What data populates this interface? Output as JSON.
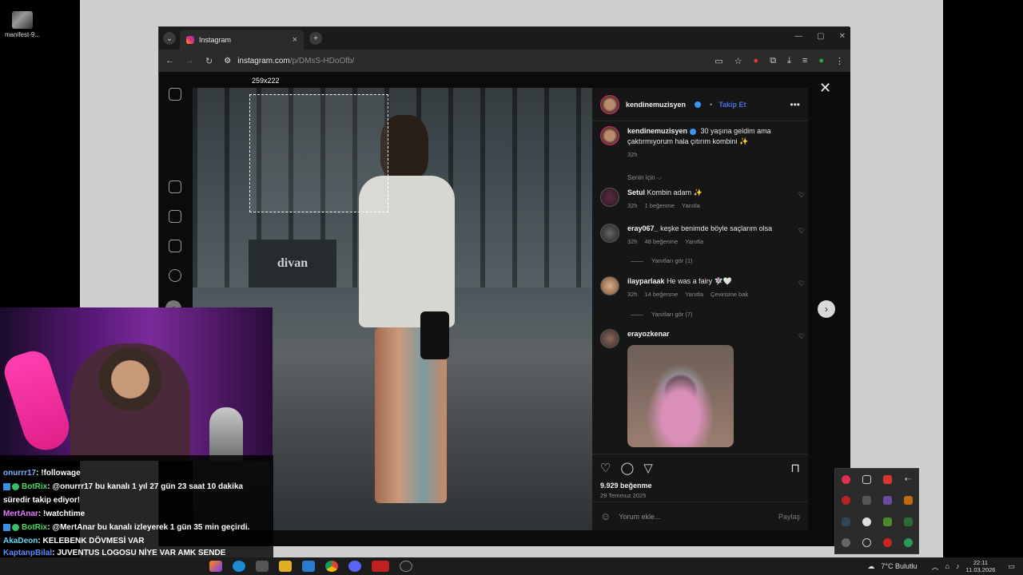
{
  "desktop": {
    "icon_label": "manifest-9..."
  },
  "browser": {
    "tab_title": "Instagram",
    "url_host": "instagram.com",
    "url_path": "/p/DMsS-HDoOfb/",
    "window_controls": [
      "—",
      "▢",
      "✕"
    ]
  },
  "selection": {
    "size_label": "259x222"
  },
  "post": {
    "username": "kendinemuzisyen",
    "follow_label": "Takip Et",
    "caption_user": "kendinemuzisyen",
    "caption_text": "30 yaşına geldim ama çaktırmıyorum hala çıtırım kombini ✨",
    "caption_time": "32h",
    "sort_label": "Senin için ⌵",
    "comments": [
      {
        "user": "Setul",
        "text": "Kombin adam ✨",
        "time": "32h",
        "likes": "1 beğenme",
        "reply": "Yanıtla"
      },
      {
        "user": "eray067_",
        "text": "keşke benimde böyle saçlarım olsa",
        "time": "32h",
        "likes": "48 beğenme",
        "reply": "Yanıtla",
        "view_replies": "Yanıtları gör (1)"
      },
      {
        "user": "ilayparlaak",
        "text": "He was a fairy 🧚🏻‍♀️🤍",
        "time": "32h",
        "likes": "14 beğenme",
        "reply": "Yanıtla",
        "translate": "Çevirisine bak",
        "view_replies": "Yanıtları gör (7)"
      },
      {
        "user": "erayozkenar",
        "text": ""
      }
    ],
    "likes_count": "9.929 beğenme",
    "post_date": "29 Temmuz 2025",
    "comment_placeholder": "Yorum ekle...",
    "post_button": "Paylaş"
  },
  "chat": [
    {
      "user": "onurrr17",
      "color": "#7fb0ff",
      "text": ": !followage"
    },
    {
      "user": "BotRix",
      "color": "#4cd964",
      "bot": true,
      "text": ": @onurrr17 bu kanalı 1 yıl 27 gün 23 saat 10 dakika süredir takip ediyor!"
    },
    {
      "user": "MertAnar",
      "color": "#e77aff",
      "text": ": !watchtime"
    },
    {
      "user": "BotRix",
      "color": "#4cd964",
      "bot": true,
      "text": ": @MertAnar bu kanalı izleyerek 1 gün 35 min geçirdi."
    },
    {
      "user": "AkaDeon",
      "color": "#62d7ff",
      "text": ": KELEBENK DÖVMESİ VAR"
    },
    {
      "user": "KaptanpBilal",
      "color": "#5a8cff",
      "text": ": JUVENTUS LOGOSU NİYE VAR AMK SENDE DHFGDYUGJHXGDSFHXDGSFJHXGZDYSFUHXCFSDHC"
    }
  ],
  "taskbar": {
    "weather": "7°C  Bulutlu",
    "time": "22:11",
    "date": "11.03.2026"
  }
}
